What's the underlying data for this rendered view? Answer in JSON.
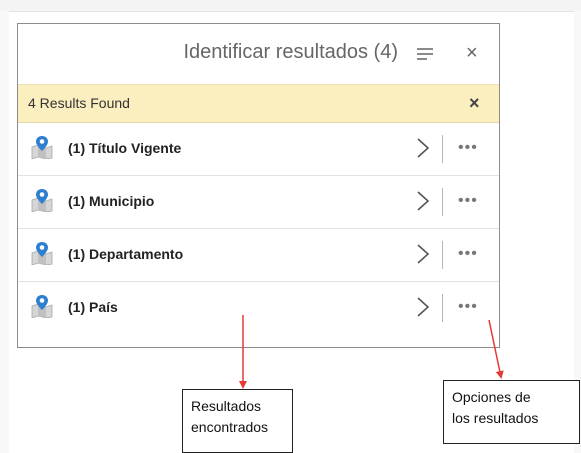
{
  "panel": {
    "title": "Identificar resultados (4)",
    "menu_icon": "hamburger-menu-icon",
    "close_icon": "close-x-icon",
    "close_symbol": "×"
  },
  "results_bar": {
    "text": "4 Results Found",
    "close_symbol": "×",
    "background": "#fbefc0"
  },
  "results": [
    {
      "label": "(1) Título Vigente",
      "icon": "map-location-pin-icon"
    },
    {
      "label": "(1) Municipio",
      "icon": "map-location-pin-icon"
    },
    {
      "label": "(1) Departamento",
      "icon": "map-location-pin-icon"
    },
    {
      "label": "(1) País",
      "icon": "map-location-pin-icon"
    }
  ],
  "row_more_symbol": "•••",
  "annotations": {
    "results_found_note": "Resultados\nencontrados",
    "options_note": "Opciones de\nlos resultados",
    "arrow_color": "#e53935"
  }
}
